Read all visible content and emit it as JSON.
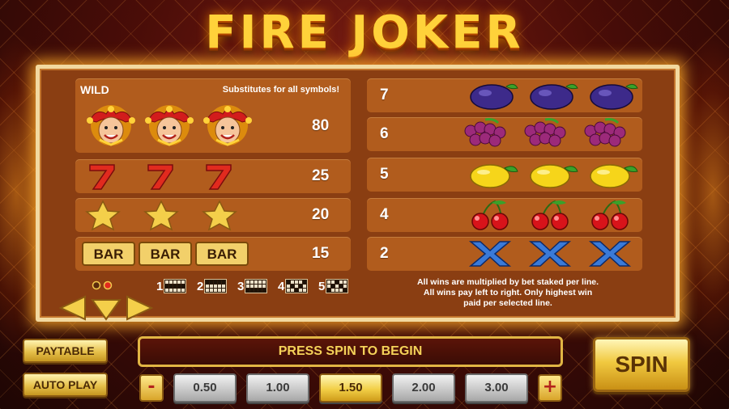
{
  "title": "FIRE JOKER",
  "paytable": {
    "wild_label": "WILD",
    "wild_description": "Substitutes for all symbols!",
    "left_rows": [
      {
        "symbol": "joker-icon",
        "payout": "80"
      },
      {
        "symbol": "seven-icon",
        "payout": "25",
        "glyph": "7"
      },
      {
        "symbol": "star-icon",
        "payout": "20"
      },
      {
        "symbol": "bar-icon",
        "payout": "15",
        "glyph": "BAR"
      }
    ],
    "right_rows": [
      {
        "symbol": "plum-icon",
        "payout": "7"
      },
      {
        "symbol": "grapes-icon",
        "payout": "6"
      },
      {
        "symbol": "lemon-icon",
        "payout": "5"
      },
      {
        "symbol": "cherry-icon",
        "payout": "4"
      },
      {
        "symbol": "x-icon",
        "payout": "2",
        "glyph": "X"
      }
    ],
    "paylines": [
      "1",
      "2",
      "3",
      "4",
      "5"
    ],
    "info_lines": [
      "All wins are multiplied by bet staked per line.",
      "All wins pay left to right. Only highest win",
      "paid per selected line."
    ]
  },
  "controls": {
    "paytable_label": "PAYTABLE",
    "autoplay_label": "AUTO PLAY",
    "message": "PRESS SPIN TO BEGIN",
    "spin_label": "SPIN",
    "bet_minus": "-",
    "bet_plus": "+",
    "bets": [
      "0.50",
      "1.00",
      "1.50",
      "2.00",
      "3.00"
    ],
    "selected_bet": "1.50"
  },
  "colors": {
    "gold": "#ffd23a",
    "panel": "#b15c1d",
    "board": "#8a3e12"
  }
}
